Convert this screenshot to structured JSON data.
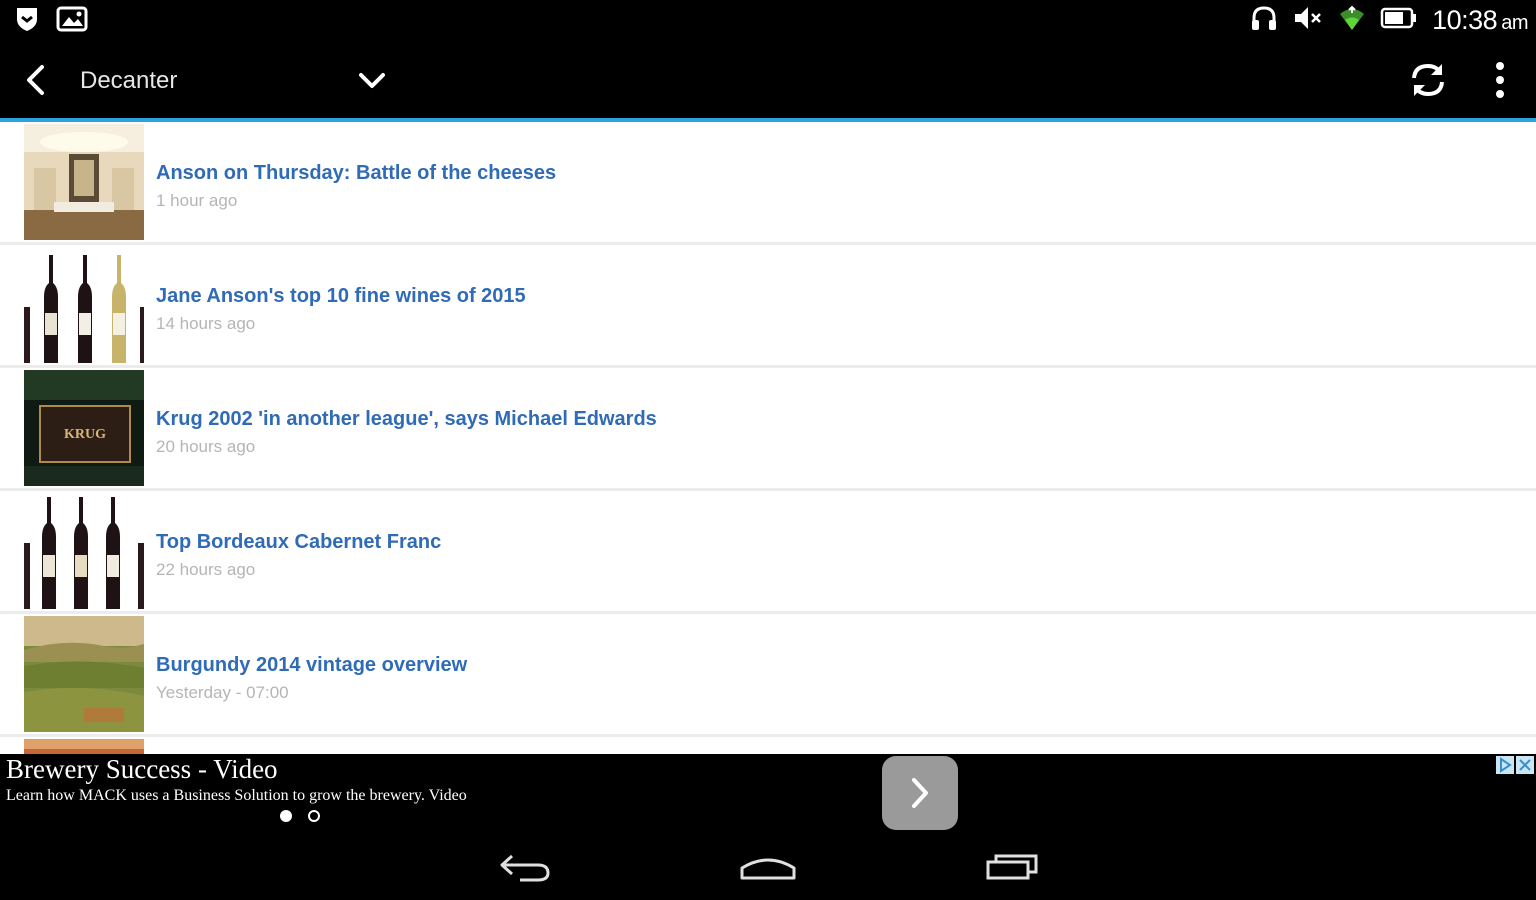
{
  "status_bar": {
    "time": "10:38",
    "ampm": "am",
    "icons": [
      "shield-icon",
      "gallery-icon",
      "headphones-icon",
      "mute-icon",
      "wifi-icon",
      "battery-icon"
    ]
  },
  "action_bar": {
    "title": "Decanter",
    "accent_color": "#2aa3df"
  },
  "articles": [
    {
      "title": "Anson on Thursday: Battle of the cheeses",
      "time": "1 hour ago"
    },
    {
      "title": "Jane Anson's top 10 fine wines of 2015",
      "time": "14 hours ago"
    },
    {
      "title": "Krug 2002 'in another league', says Michael Edwards",
      "time": "20 hours ago"
    },
    {
      "title": "Top Bordeaux Cabernet Franc",
      "time": "22 hours ago"
    },
    {
      "title": "Burgundy 2014 vintage overview",
      "time": "Yesterday - 07:00"
    }
  ],
  "ad": {
    "title": "Brewery Success - Video",
    "description": "Learn how MACK uses a Business Solution to grow the brewery. Video",
    "page_count": 2,
    "active_page": 1
  },
  "colors": {
    "article_title": "#2f6bb7",
    "article_time": "#b5b5b5"
  }
}
